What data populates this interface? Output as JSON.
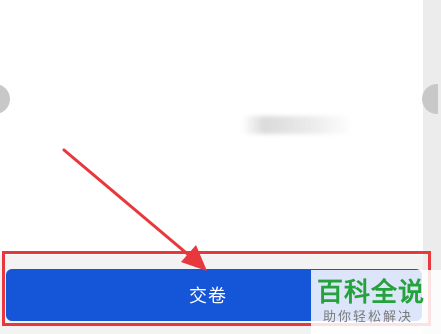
{
  "submit_button": {
    "label": "交卷"
  },
  "watermark": {
    "title": "百科全说",
    "subtitle": "助你轻松解决"
  },
  "colors": {
    "button": "#1555d8",
    "highlight": "#e8383d",
    "watermark_green": "#25a23b"
  },
  "icons": {
    "left_nav": "chevron-left-icon",
    "right_nav": "chevron-right-icon"
  }
}
